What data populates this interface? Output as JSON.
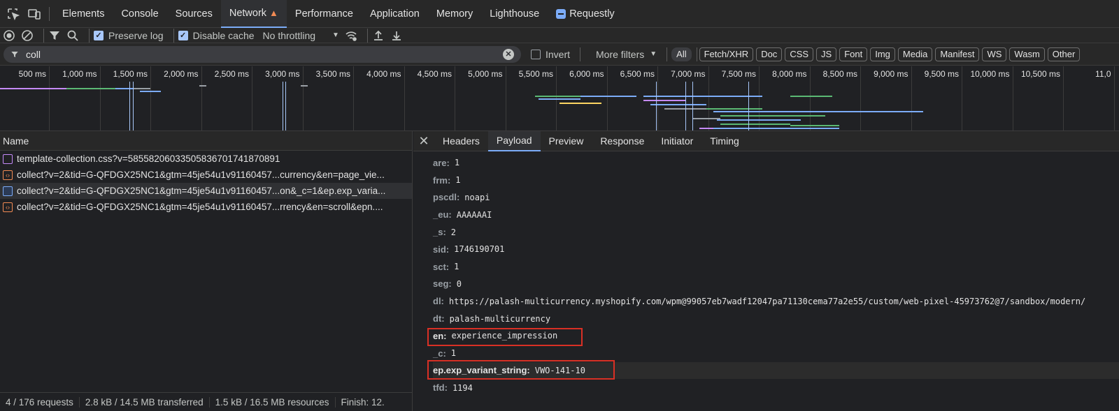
{
  "top_tabs": [
    "Elements",
    "Console",
    "Sources",
    "Network",
    "Performance",
    "Application",
    "Memory",
    "Lighthouse",
    "Requestly"
  ],
  "active_tab": "Network",
  "toolbar": {
    "preserve_log": "Preserve log",
    "disable_cache": "Disable cache",
    "throttling": "No throttling"
  },
  "filter": {
    "value": "coll",
    "invert": "Invert",
    "more_filters": "More filters",
    "chips": [
      "All",
      "Fetch/XHR",
      "Doc",
      "CSS",
      "JS",
      "Font",
      "Img",
      "Media",
      "Manifest",
      "WS",
      "Wasm",
      "Other"
    ]
  },
  "timeline_labels": [
    "500 ms",
    "1,000 ms",
    "1,500 ms",
    "2,000 ms",
    "2,500 ms",
    "3,000 ms",
    "3,500 ms",
    "4,000 ms",
    "4,500 ms",
    "5,000 ms",
    "5,500 ms",
    "6,000 ms",
    "6,500 ms",
    "7,000 ms",
    "7,500 ms",
    "8,000 ms",
    "8,500 ms",
    "9,000 ms",
    "9,500 ms",
    "10,000 ms",
    "10,500 ms",
    "11,0"
  ],
  "requests": {
    "header": "Name",
    "rows": [
      {
        "name": "template-collection.css?v=585582060335058367017418708​91",
        "type": "css"
      },
      {
        "name": "collect?v=2&tid=G-QFDGX25NC1&gtm=45je54u1v91160457...currency&en=page_vie...",
        "type": "xhr"
      },
      {
        "name": "collect?v=2&tid=G-QFDGX25NC1&gtm=45je54u1v91160457...on&_c=1&ep.exp_varia...",
        "type": "doc"
      },
      {
        "name": "collect?v=2&tid=G-QFDGX25NC1&gtm=45je54u1v91160457...rrency&en=scroll&epn....",
        "type": "xhr"
      }
    ]
  },
  "footer": {
    "requests": "4 / 176 requests",
    "transferred": "2.8 kB / 14.5 MB transferred",
    "resources": "1.5 kB / 16.5 MB resources",
    "finish": "Finish: 12."
  },
  "detail_tabs": [
    "Headers",
    "Payload",
    "Preview",
    "Response",
    "Initiator",
    "Timing"
  ],
  "active_detail_tab": "Payload",
  "payload": [
    {
      "key": "are:",
      "value": "1"
    },
    {
      "key": "frm:",
      "value": "1"
    },
    {
      "key": "pscdl:",
      "value": "noapi"
    },
    {
      "key": "_eu:",
      "value": "AAAAAAI"
    },
    {
      "key": "_s:",
      "value": "2"
    },
    {
      "key": "sid:",
      "value": "1746190701"
    },
    {
      "key": "sct:",
      "value": "1"
    },
    {
      "key": "seg:",
      "value": "0"
    },
    {
      "key": "dl:",
      "value": "https://palash-multicurrency.myshopify.com/wpm@99057eb7wadf12047pa71130cema77a2e55/custom/web-pixel-45973762@7/sandbox/modern/"
    },
    {
      "key": "dt:",
      "value": "palash-multicurrency"
    },
    {
      "key": "en:",
      "value": "experience_impression"
    },
    {
      "key": "_c:",
      "value": "1"
    },
    {
      "key": "ep.exp_variant_string:",
      "value": "VWO-141-10"
    },
    {
      "key": "tfd:",
      "value": "1194"
    }
  ]
}
